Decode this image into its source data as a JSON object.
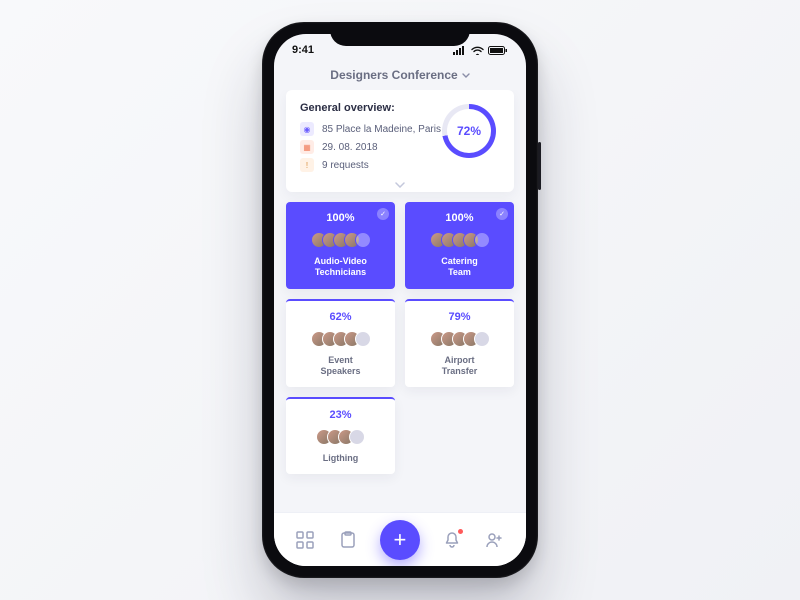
{
  "statusbar": {
    "time": "9:41"
  },
  "header": {
    "title": "Designers Conference"
  },
  "overview": {
    "title": "General overview:",
    "location": "85 Place la Madeine, Paris",
    "date": "29. 08. 2018",
    "requests": "9 requests",
    "progress_pct": "72%"
  },
  "cards": [
    {
      "pct": "100%",
      "label_l1": "Audio-Video",
      "label_l2": "Technicians",
      "complete": true
    },
    {
      "pct": "100%",
      "label_l1": "Catering",
      "label_l2": "Team",
      "complete": true
    },
    {
      "pct": "62%",
      "label_l1": "Event",
      "label_l2": "Speakers",
      "complete": false
    },
    {
      "pct": "79%",
      "label_l1": "Airport",
      "label_l2": "Transfer",
      "complete": false
    },
    {
      "pct": "23%",
      "label_l1": "Ligthing",
      "label_l2": "",
      "complete": false
    }
  ],
  "colors": {
    "accent": "#5a4cff"
  }
}
